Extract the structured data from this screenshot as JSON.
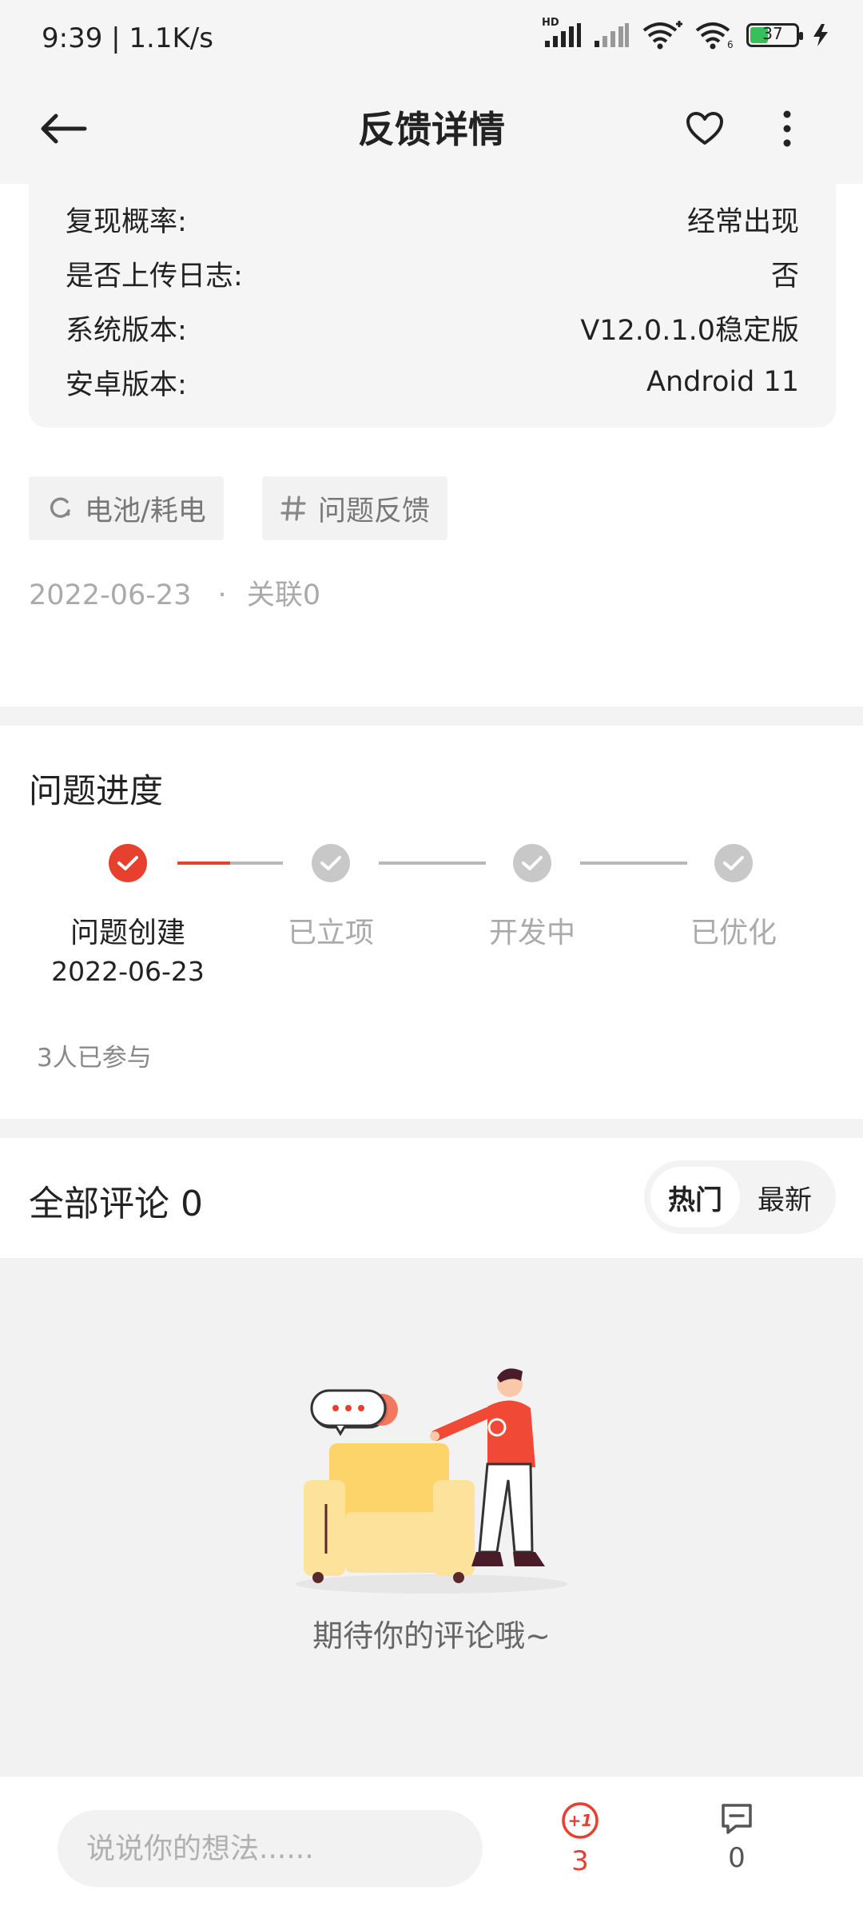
{
  "status_bar": {
    "time": "9:39 | 1.1K/s",
    "battery_level": "37",
    "network_label": "HD"
  },
  "top_bar": {
    "title": "反馈详情"
  },
  "info": [
    {
      "label": "复现概率:",
      "value": "经常出现"
    },
    {
      "label": "是否上传日志:",
      "value": "否"
    },
    {
      "label": "系统版本:",
      "value": "V12.0.1.0稳定版"
    },
    {
      "label": "安卓版本:",
      "value": "Android 11"
    }
  ],
  "tags": [
    {
      "label": "电池/耗电",
      "icon": "battery-loop-icon"
    },
    {
      "label": "问题反馈",
      "icon": "hash-icon"
    }
  ],
  "meta": {
    "date": "2022-06-23",
    "separator": "·",
    "related": "关联0"
  },
  "progress": {
    "title": "问题进度",
    "steps": [
      {
        "label": "问题创建",
        "date": "2022-06-23",
        "done": true
      },
      {
        "label": "已立项",
        "done": false
      },
      {
        "label": "开发中",
        "done": false
      },
      {
        "label": "已优化",
        "done": false
      }
    ],
    "participants": "3人已参与"
  },
  "comments": {
    "title": "全部评论 0",
    "sort_options": [
      "热门",
      "最新"
    ],
    "active_sort": "热门",
    "empty_text": "期待你的评论哦~"
  },
  "bottom_bar": {
    "input_placeholder": "说说你的想法......",
    "plus_one_count": "3",
    "comment_count": "0"
  },
  "colors": {
    "accent": "#e8402e",
    "pending": "#c8c8c8",
    "background_gray": "#f2f2f2"
  }
}
